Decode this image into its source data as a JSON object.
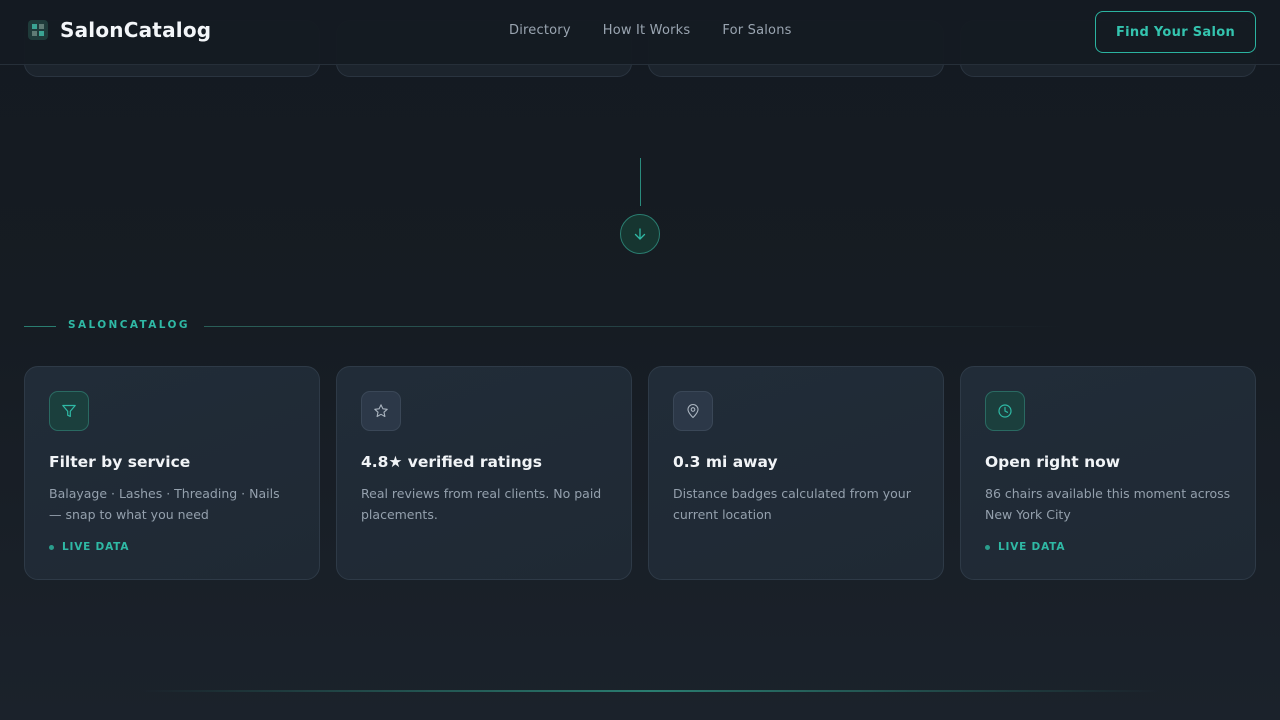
{
  "header": {
    "brand_name": "SalonCatalog",
    "nav": [
      "Directory",
      "How It Works",
      "For Salons"
    ],
    "cta_label": "Find Your Salon"
  },
  "section": {
    "label": "SALONCATALOG"
  },
  "cards": [
    {
      "icon": "filter-icon",
      "title": "Filter by service",
      "description": "Balayage · Lashes · Threading · Nails — snap to what you need",
      "badge": "LIVE DATA"
    },
    {
      "icon": "star-icon",
      "title": "4.8★ verified ratings",
      "description": "Real reviews from real clients. No paid placements.",
      "badge": ""
    },
    {
      "icon": "map-pin-icon",
      "title": "0.3 mi away",
      "description": "Distance badges calculated from your current location",
      "badge": ""
    },
    {
      "icon": "clock-icon",
      "title": "Open right now",
      "description": "86 chairs available this moment across New York City",
      "badge": "LIVE DATA"
    }
  ],
  "colors": {
    "accent": "#2fb9a5",
    "background": "#161c23",
    "card": "#212c38"
  }
}
